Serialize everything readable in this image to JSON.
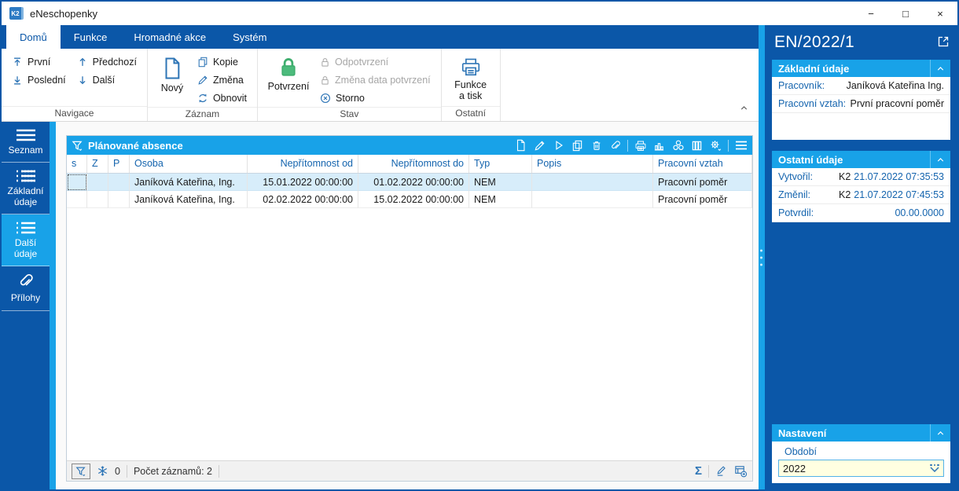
{
  "window": {
    "title": "eNeschopenky",
    "logo": "K2",
    "controls": {
      "minimize": "−",
      "maximize": "□",
      "close": "×"
    }
  },
  "tabs": [
    {
      "label": "Domů",
      "active": true
    },
    {
      "label": "Funkce",
      "active": false
    },
    {
      "label": "Hromadné akce",
      "active": false
    },
    {
      "label": "Systém",
      "active": false
    }
  ],
  "ribbon": {
    "navigace": {
      "label": "Navigace",
      "first": "První",
      "previous": "Předchozí",
      "last": "Poslední",
      "next": "Další"
    },
    "zaznam": {
      "label": "Záznam",
      "new": "Nový",
      "copy": "Kopie",
      "change": "Změna",
      "refresh": "Obnovit"
    },
    "stav": {
      "label": "Stav",
      "confirm": "Potvrzení",
      "unconfirm": "Odpotvrzení",
      "change_confirm_date": "Změna data potvrzení",
      "cancel": "Storno"
    },
    "ostatni": {
      "label": "Ostatní",
      "functions_print": "Funkce a tisk"
    }
  },
  "sidebar": {
    "items": [
      {
        "label": "Seznam",
        "active": false
      },
      {
        "label": "Základní údaje",
        "active": false
      },
      {
        "label": "Další údaje",
        "active": true
      },
      {
        "label": "Přílohy",
        "active": false
      }
    ]
  },
  "grid": {
    "title": "Plánované absence",
    "toolbar_icons": [
      "new",
      "edit",
      "run",
      "copy",
      "delete",
      "attachment",
      "print",
      "chart",
      "reports",
      "columns",
      "settings",
      "menu"
    ],
    "columns": {
      "s": "s",
      "z": "Z",
      "p": "P",
      "osoba": "Osoba",
      "od": "Nepřítomnost od",
      "do": "Nepřítomnost do",
      "typ": "Typ",
      "popis": "Popis",
      "vztah": "Pracovní vztah"
    },
    "rows": [
      {
        "s": "",
        "z": "",
        "p": "",
        "osoba": "Janíková Kateřina, Ing.",
        "od": "15.01.2022 00:00:00",
        "do": "01.02.2022 00:00:00",
        "typ": "NEM",
        "popis": "",
        "vztah": "Pracovní poměr"
      },
      {
        "s": "",
        "z": "",
        "p": "",
        "osoba": "Janíková Kateřina, Ing.",
        "od": "02.02.2022 00:00:00",
        "do": "15.02.2022 00:00:00",
        "typ": "NEM",
        "popis": "",
        "vztah": "Pracovní poměr"
      }
    ],
    "status": {
      "filter_count": "0",
      "records_label": "Počet záznamů: 2",
      "sum_glyph": "Σ",
      "right_icons": [
        "sum",
        "edit",
        "add-view"
      ]
    }
  },
  "panel": {
    "title": "EN/2022/1",
    "zakladni": {
      "title": "Základní údaje",
      "rows": [
        {
          "label": "Pracovník:",
          "value": "Janíková Kateřina Ing."
        },
        {
          "label": "Pracovní vztah:",
          "value": "První pracovní poměr"
        }
      ]
    },
    "ostatni": {
      "title": "Ostatní údaje",
      "rows": [
        {
          "label": "Vytvořil:",
          "user": "K2",
          "datetime": "21.07.2022 07:35:53"
        },
        {
          "label": "Změnil:",
          "user": "K2",
          "datetime": "21.07.2022 07:45:53"
        },
        {
          "label": "Potvrdil:",
          "user": "",
          "datetime": "00.00.0000"
        }
      ]
    },
    "nastaveni": {
      "title": "Nastavení",
      "field_label": "Období",
      "field_value": "2022"
    }
  },
  "colors": {
    "dark_blue": "#0B57A8",
    "accent_cyan": "#18A2E8",
    "selection_blue": "#D7EDFA",
    "link_blue": "#1464AE",
    "icon_blue": "#2E75B6",
    "confirm_green": "#4CBB7C",
    "input_yellow": "#FFFFE1"
  }
}
